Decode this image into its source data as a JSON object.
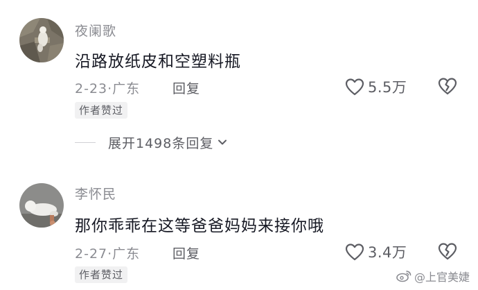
{
  "comments": [
    {
      "username": "夜阑歌",
      "text": "沿路放纸皮和空塑料瓶",
      "date": "2-23",
      "separator": "·",
      "location": "广东",
      "reply_label": "回复",
      "like_count": "5.5万",
      "badge": "作者赞过",
      "avatar": "stone-and-cat-photo"
    },
    {
      "username": "李怀民",
      "text": "那你乖乖在这等爸爸妈妈来接你哦",
      "date": "2-27",
      "separator": "·",
      "location": "广东",
      "reply_label": "回复",
      "like_count": "3.4万",
      "badge": "作者赞过",
      "avatar": "white-cat-photo"
    }
  ],
  "expand_replies": {
    "label": "展开1498条回复",
    "icon": "chevron-down-icon"
  },
  "watermark": {
    "icon": "weibo-icon",
    "text": "@上官美婕"
  },
  "colors": {
    "primary_text": "#161823",
    "secondary_text": "#8a8b91",
    "action_text": "#5c5d63",
    "badge_bg": "#f1f1f2"
  }
}
